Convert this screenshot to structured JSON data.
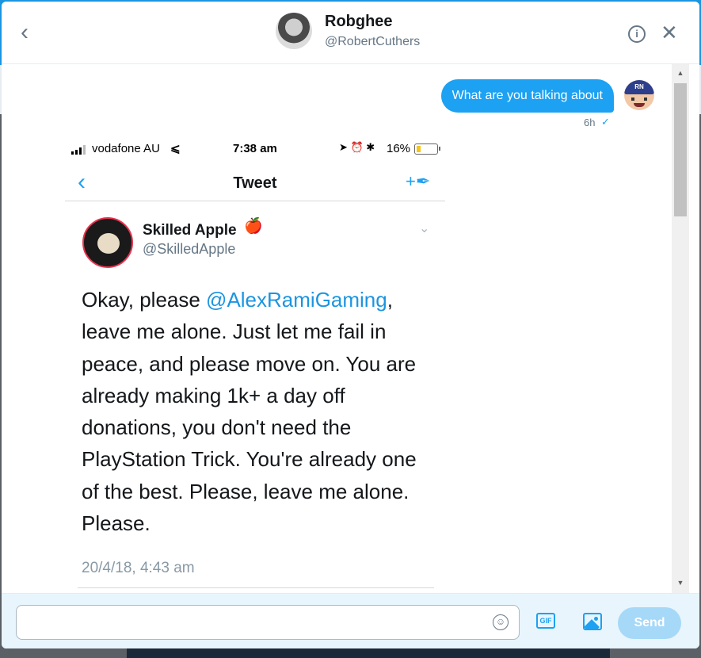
{
  "header": {
    "name": "Robghee",
    "handle": "@RobertCuthers",
    "back_icon": "chevron-left-icon",
    "info_icon": "info-icon",
    "close_icon": "close-icon"
  },
  "conversation": {
    "message_text": "What are you talking about",
    "message_time": "6h",
    "sent_avatar_text": "RN",
    "attached_screenshot": {
      "status_bar": {
        "carrier": "vodafone AU",
        "time": "7:38 am",
        "battery": "16%"
      },
      "nav": {
        "title": "Tweet"
      },
      "tweet": {
        "author_name": "Skilled Apple",
        "author_emoji": "🍎",
        "author_handle": "@SkilledApple",
        "text_before": "Okay, please ",
        "mention": "@AlexRamiGaming",
        "text_after": ", leave me alone. Just let me fail in peace, and please move on. You are already making 1k+ a day off donations, you don't need the PlayStation Trick. You're already one of the best. Please, leave me alone. Please.",
        "date": "20/4/18, 4:43 am"
      }
    }
  },
  "composer": {
    "input_value": "",
    "input_placeholder": "",
    "gif_label": "GIF",
    "send_label": "Send"
  },
  "colors": {
    "accent": "#1da1f2",
    "send_disabled": "#a6d8f8",
    "mention": "#1b95e0"
  }
}
